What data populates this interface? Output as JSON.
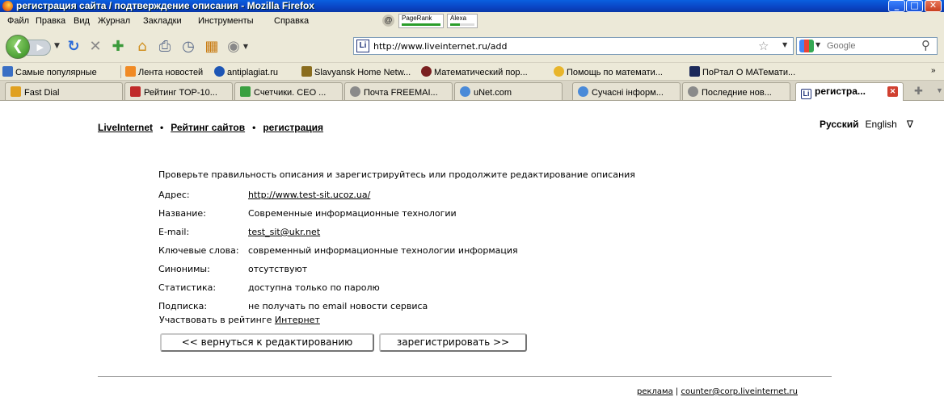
{
  "window": {
    "title": "регистрация сайта / подтверждение описания - Mozilla Firefox",
    "min_label": "_",
    "max_label": "□",
    "close_label": "✕"
  },
  "menu": {
    "items": [
      "Файл",
      "Правка",
      "Вид",
      "Журнал",
      "Закладки",
      "Инструменты",
      "Справка"
    ],
    "pagerank_label": "PageRank",
    "alexa_label": "Alexa"
  },
  "nav": {
    "url": "http://www.liveinternet.ru/add",
    "url_favicon_text": "Li",
    "search_placeholder": "Google"
  },
  "bookmarks": [
    {
      "label": "Самые популярные",
      "icon": "blue-square-icon",
      "color": "#3a6fc4"
    },
    {
      "label": "Лента новостей",
      "icon": "rss-icon",
      "color": "#f08a24"
    },
    {
      "label": "antiplagiat.ru",
      "icon": "circle-logo-icon",
      "color": "#1e56b5"
    },
    {
      "label": "Slavyansk Home Netw...",
      "icon": "cdc-icon",
      "color": "#8a6d1e"
    },
    {
      "label": "Математический пор...",
      "icon": "hat-icon",
      "color": "#7a2020"
    },
    {
      "label": "Помощь по математи...",
      "icon": "star-icon",
      "color": "#e8b52a"
    },
    {
      "label": "ПоРтал О МАТемати...",
      "icon": "graduation-cap-icon",
      "color": "#1c2a5a"
    }
  ],
  "bookmarks_more": "»",
  "tabs": [
    {
      "label": "Fast Dial",
      "color": "#e0a020",
      "active": false
    },
    {
      "label": "Рейтинг TOP-10...",
      "color": "#c02a2a",
      "active": false
    },
    {
      "label": "Счетчики. СЕО ...",
      "color": "#3aa040",
      "active": false
    },
    {
      "label": "Почта FREEMAI...",
      "color": "#8a8a8a",
      "active": false
    },
    {
      "label": "uNet.com",
      "color": "#4a8ad8",
      "active": false
    },
    {
      "label": "Сучасні інформ...",
      "color": "#4a8ad8",
      "active": false
    },
    {
      "label": "Последние нов...",
      "color": "#8a8a8a",
      "active": false
    },
    {
      "label": "регистра...",
      "color": "#22357a",
      "active": true
    }
  ],
  "page": {
    "breadcrumb": [
      "LiveInternet",
      "Рейтинг сайтов",
      "регистрация"
    ],
    "lang_current": "Русский",
    "lang_other": "English",
    "lang_toggle": "∇",
    "intro": "Проверьте правильность описания и зарегистрируйтесь или продолжите редактирование описания",
    "fields": [
      {
        "key": "Адрес:",
        "value": "http://www.test-sit.ucoz.ua/",
        "link": true
      },
      {
        "key": "Название:",
        "value": "Современные информационные технологии",
        "link": false
      },
      {
        "key": "E-mail:",
        "value": "test_sit@ukr.net",
        "link": true
      },
      {
        "key": "Ключевые слова:",
        "value": "современный информационные технологии информация",
        "link": false
      },
      {
        "key": "Синонимы:",
        "value": "отсутствуют",
        "link": false
      },
      {
        "key": "Статистика:",
        "value": "доступна только по паролю",
        "link": false
      },
      {
        "key": "Подписка:",
        "value": "не получать по email новости сервиса",
        "link": false
      }
    ],
    "participate_text": "Участвовать в рейтинге",
    "participate_link": "Интернет",
    "back_button": "<< вернуться к редактированию",
    "register_button": "зарегистрировать >>",
    "footer_ads": "реклама",
    "footer_sep": "|",
    "footer_email": "counter@corp.liveinternet.ru"
  }
}
